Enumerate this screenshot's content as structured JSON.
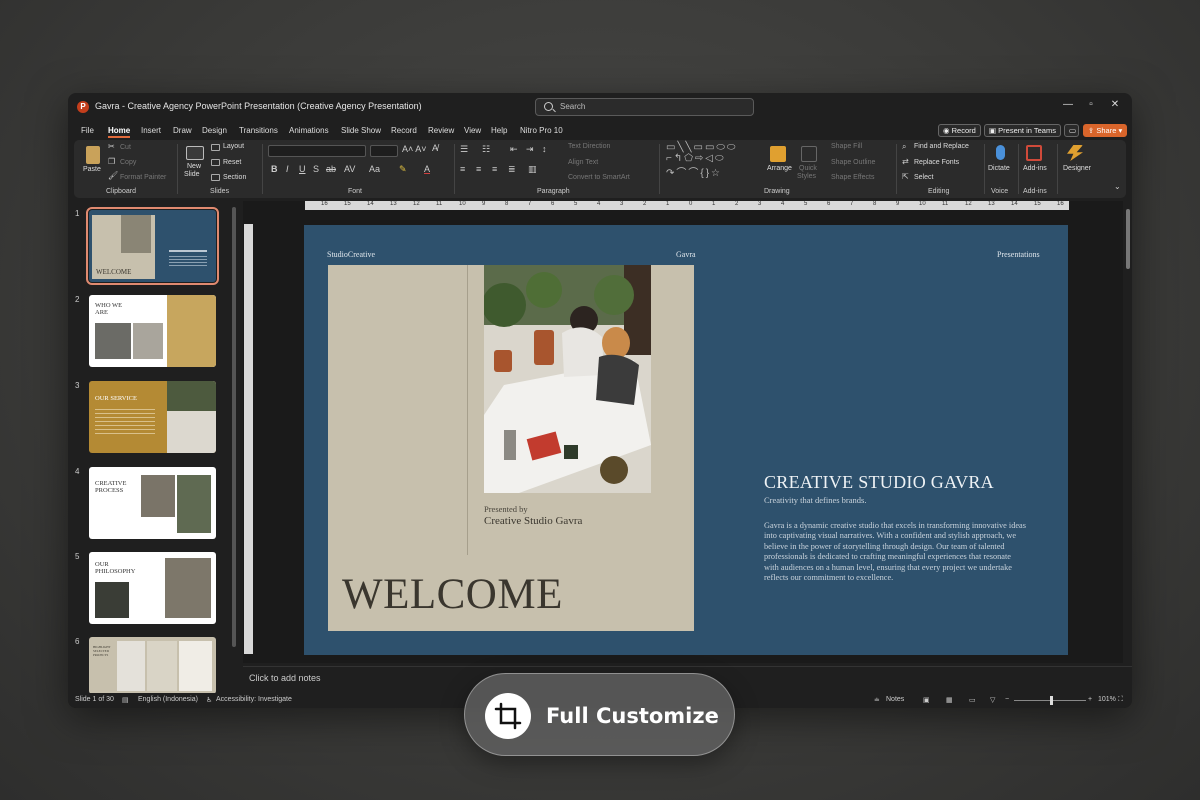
{
  "window": {
    "title": "Gavra - Creative Agency PowerPoint Presentation (Creative Agency Presentation)",
    "search_placeholder": "Search"
  },
  "tabs": [
    "File",
    "Home",
    "Insert",
    "Draw",
    "Design",
    "Transitions",
    "Animations",
    "Slide Show",
    "Record",
    "Review",
    "View",
    "Help",
    "Nitro Pro 10"
  ],
  "active_tab": "Home",
  "top_buttons": {
    "record": "Record",
    "present_teams": "Present in Teams",
    "share": "Share"
  },
  "ribbon": {
    "clipboard": {
      "label": "Clipboard",
      "paste": "Paste",
      "cut": "Cut",
      "copy": "Copy",
      "format_painter": "Format Painter"
    },
    "slides": {
      "label": "Slides",
      "new_slide_1": "New",
      "new_slide_2": "Slide",
      "layout": "Layout",
      "reset": "Reset",
      "section": "Section"
    },
    "font": {
      "label": "Font"
    },
    "paragraph": {
      "label": "Paragraph",
      "text_direction": "Text Direction",
      "align_text": "Align Text",
      "convert_smartart": "Convert to SmartArt"
    },
    "drawing": {
      "label": "Drawing",
      "arrange": "Arrange",
      "quick_styles_1": "Quick",
      "quick_styles_2": "Styles",
      "shape_fill": "Shape Fill",
      "shape_outline": "Shape Outline",
      "shape_effects": "Shape Effects"
    },
    "editing": {
      "label": "Editing",
      "find_replace": "Find and Replace",
      "replace_fonts": "Replace Fonts",
      "select": "Select"
    },
    "voice": {
      "label": "Voice",
      "dictate": "Dictate"
    },
    "addins": {
      "label": "Add-ins",
      "addins": "Add-ins"
    },
    "designer": {
      "designer": "Designer"
    }
  },
  "ruler_numbers": [
    "16",
    "15",
    "14",
    "13",
    "12",
    "11",
    "10",
    "9",
    "8",
    "7",
    "6",
    "5",
    "4",
    "3",
    "2",
    "1",
    "0",
    "1",
    "2",
    "3",
    "4",
    "5",
    "6",
    "7",
    "8",
    "9",
    "10",
    "11",
    "12",
    "13",
    "14",
    "15",
    "16"
  ],
  "thumbnails": [
    {
      "num": "1",
      "title": "WELCOME"
    },
    {
      "num": "2",
      "title": "WHO WE ARE"
    },
    {
      "num": "3",
      "title": "OUR SERVICE"
    },
    {
      "num": "4",
      "title": "CREATIVE PROCESS"
    },
    {
      "num": "5",
      "title": "OUR PHILOSOPHY"
    },
    {
      "num": "6",
      "title": "HIGHLIGHT SELECTED PROJECTS"
    }
  ],
  "slide": {
    "top_left": "StudioCreative",
    "top_center": "Gavra",
    "top_right": "Presentations",
    "presented_by": "Presented by",
    "presented_name": "Creative Studio Gavra",
    "welcome": "WELCOME",
    "headline": "CREATIVE STUDIO GAVRA",
    "tagline": "Creativity that defines brands.",
    "body": "Gavra is a dynamic creative studio that excels in transforming innovative ideas into captivating visual narratives. With a confident and stylish approach, we believe in the power of storytelling through design. Our team of talented professionals is dedicated to crafting meaningful experiences that resonate with audiences on a human level, ensuring that every project we undertake reflects our commitment to excellence."
  },
  "notes_placeholder": "Click to add notes",
  "status": {
    "slide_info": "Slide 1 of 30",
    "language": "English (Indonesia)",
    "accessibility": "Accessibility: Investigate",
    "notes": "Notes",
    "zoom": "101%"
  },
  "overlay": {
    "label": "Full Customize"
  },
  "colors": {
    "accent": "#e0693a",
    "slide_bg": "#2e516d",
    "beige": "#c7c0ad",
    "share": "#d9652b"
  }
}
